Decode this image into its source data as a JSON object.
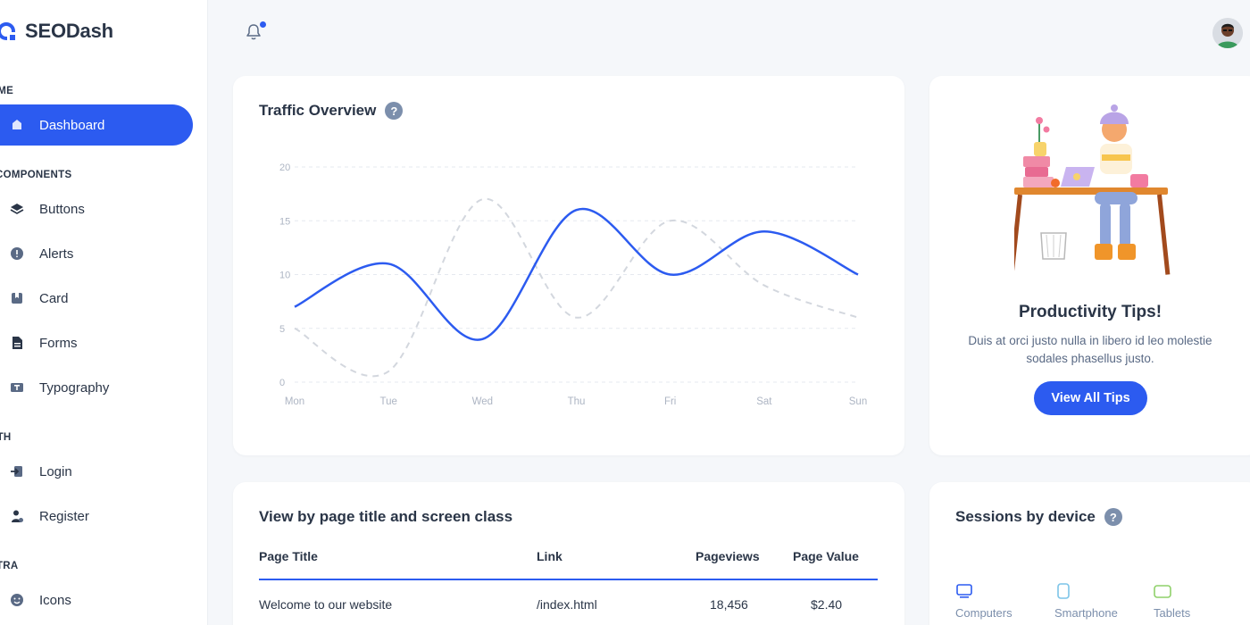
{
  "brand": {
    "name": "SEODash",
    "accent": "#2c5bf0"
  },
  "topbar": {
    "notification_icon": "bell-icon",
    "has_unread": true
  },
  "sidebar": {
    "sections": [
      {
        "label": "OME"
      },
      {
        "label": "I COMPONENTS"
      },
      {
        "label": "UTH"
      },
      {
        "label": "XTRA"
      }
    ],
    "items": [
      {
        "label": "Dashboard",
        "icon": "dashboard-icon",
        "active": true
      },
      {
        "label": "Buttons",
        "icon": "layers-icon"
      },
      {
        "label": "Alerts",
        "icon": "alert-circle-icon"
      },
      {
        "label": "Card",
        "icon": "bookmark-card-icon"
      },
      {
        "label": "Forms",
        "icon": "file-icon"
      },
      {
        "label": "Typography",
        "icon": "typography-icon"
      },
      {
        "label": "Login",
        "icon": "login-icon"
      },
      {
        "label": "Register",
        "icon": "user-plus-icon"
      },
      {
        "label": "Icons",
        "icon": "mood-icon"
      }
    ]
  },
  "traffic": {
    "title": "Traffic Overview",
    "chart_data": {
      "type": "line",
      "categories": [
        "Mon",
        "Tue",
        "Wed",
        "Thu",
        "Fri",
        "Sat",
        "Sun"
      ],
      "series": [
        {
          "values": [
            7,
            11,
            4,
            16,
            10,
            14,
            10
          ],
          "color": "#2c5bf0",
          "style": "solid"
        },
        {
          "values": [
            5,
            1,
            17,
            6,
            15,
            9,
            6
          ],
          "color": "#d3d7de",
          "style": "dashed"
        }
      ],
      "yticks": [
        0,
        5,
        10,
        15,
        20
      ],
      "ylim": [
        0,
        20
      ],
      "grid": true
    }
  },
  "tips": {
    "title": "Productivity Tips!",
    "text": "Duis at orci justo nulla in libero id leo molestie sodales phasellus justo.",
    "button": "View All Tips"
  },
  "pages": {
    "title": "View by page title and screen class",
    "columns": [
      "Page Title",
      "Link",
      "Pageviews",
      "Page Value"
    ],
    "rows": [
      [
        "Welcome to our website",
        "/index.html",
        "18,456",
        "$2.40"
      ]
    ]
  },
  "sessions": {
    "title": "Sessions by device",
    "devices": [
      {
        "label": "Computers",
        "icon": "monitor-icon",
        "color": "#2c5bf0"
      },
      {
        "label": "Smartphone",
        "icon": "smartphone-icon",
        "color": "#7cc4e8"
      },
      {
        "label": "Tablets",
        "icon": "tablet-icon",
        "color": "#8fd16a"
      }
    ]
  }
}
